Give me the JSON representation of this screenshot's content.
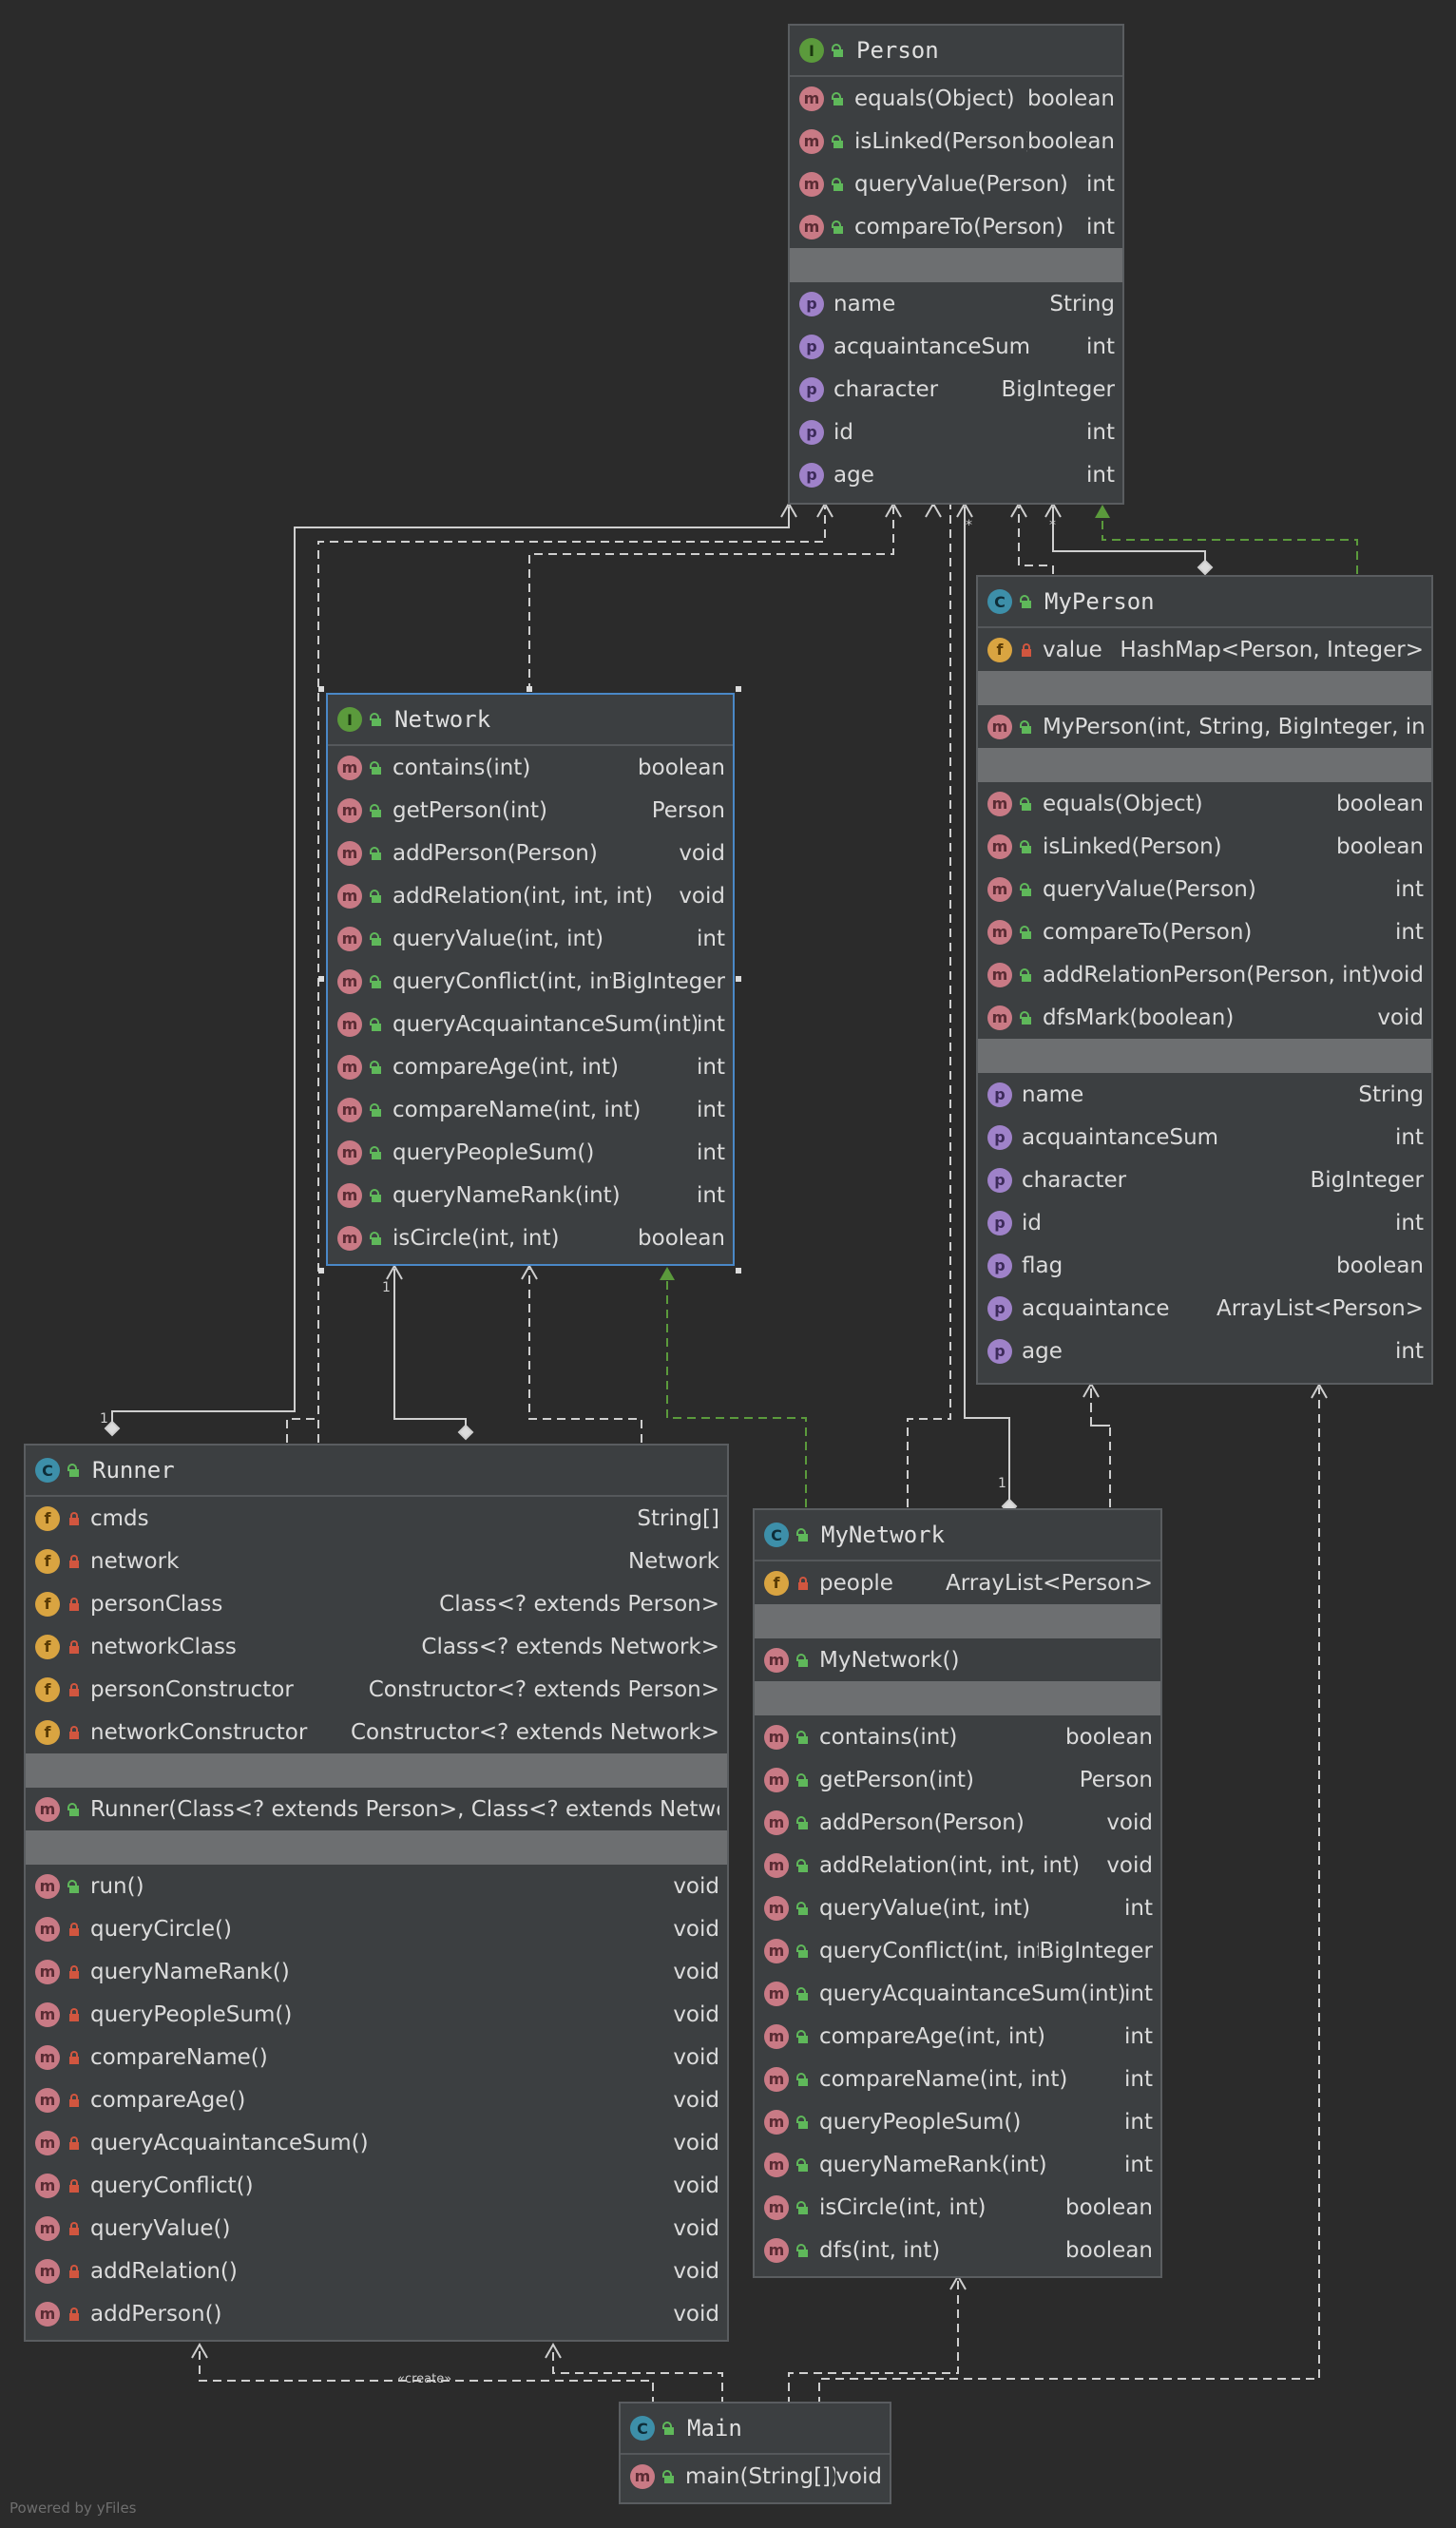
{
  "person": {
    "name": "Person",
    "kind_icon": "I",
    "methods": [
      {
        "label": "equals(Object)",
        "type": "boolean"
      },
      {
        "label": "isLinked(Person)",
        "type": "boolean"
      },
      {
        "label": "queryValue(Person)",
        "type": "int"
      },
      {
        "label": "compareTo(Person)",
        "type": "int"
      }
    ],
    "properties": [
      {
        "label": "name",
        "type": "String"
      },
      {
        "label": "acquaintanceSum",
        "type": "int"
      },
      {
        "label": "character",
        "type": "BigInteger"
      },
      {
        "label": "id",
        "type": "int"
      },
      {
        "label": "age",
        "type": "int"
      }
    ]
  },
  "network": {
    "name": "Network",
    "kind_icon": "I",
    "methods": [
      {
        "label": "contains(int)",
        "type": "boolean"
      },
      {
        "label": "getPerson(int)",
        "type": "Person"
      },
      {
        "label": "addPerson(Person)",
        "type": "void"
      },
      {
        "label": "addRelation(int, int, int)",
        "type": "void"
      },
      {
        "label": "queryValue(int, int)",
        "type": "int"
      },
      {
        "label": "queryConflict(int, int)",
        "type": "BigInteger"
      },
      {
        "label": "queryAcquaintanceSum(int)",
        "type": "int"
      },
      {
        "label": "compareAge(int, int)",
        "type": "int"
      },
      {
        "label": "compareName(int, int)",
        "type": "int"
      },
      {
        "label": "queryPeopleSum()",
        "type": "int"
      },
      {
        "label": "queryNameRank(int)",
        "type": "int"
      },
      {
        "label": "isCircle(int, int)",
        "type": "boolean"
      }
    ]
  },
  "myperson": {
    "name": "MyPerson",
    "kind_icon": "C",
    "fields": [
      {
        "label": "value",
        "type": "HashMap<Person, Integer>"
      }
    ],
    "constructors": [
      {
        "label": "MyPerson(int, String, BigInteger, int)",
        "type": ""
      }
    ],
    "methods": [
      {
        "label": "equals(Object)",
        "type": "boolean"
      },
      {
        "label": "isLinked(Person)",
        "type": "boolean"
      },
      {
        "label": "queryValue(Person)",
        "type": "int"
      },
      {
        "label": "compareTo(Person)",
        "type": "int"
      },
      {
        "label": "addRelationPerson(Person, int)",
        "type": "void"
      },
      {
        "label": "dfsMark(boolean)",
        "type": "void"
      }
    ],
    "properties": [
      {
        "label": "name",
        "type": "String"
      },
      {
        "label": "acquaintanceSum",
        "type": "int"
      },
      {
        "label": "character",
        "type": "BigInteger"
      },
      {
        "label": "id",
        "type": "int"
      },
      {
        "label": "flag",
        "type": "boolean"
      },
      {
        "label": "acquaintance",
        "type": "ArrayList<Person>"
      },
      {
        "label": "age",
        "type": "int"
      }
    ]
  },
  "runner": {
    "name": "Runner",
    "kind_icon": "C",
    "fields": [
      {
        "label": "cmds",
        "type": "String[]"
      },
      {
        "label": "network",
        "type": "Network"
      },
      {
        "label": "personClass",
        "type": "Class<? extends Person>"
      },
      {
        "label": "networkClass",
        "type": "Class<? extends Network>"
      },
      {
        "label": "personConstructor",
        "type": "Constructor<? extends Person>"
      },
      {
        "label": "networkConstructor",
        "type": "Constructor<? extends Network>"
      }
    ],
    "constructors": [
      {
        "label": "Runner(Class<? extends Person>, Class<? extends Network>)",
        "type": ""
      }
    ],
    "methods": [
      {
        "label": "run()",
        "type": "void",
        "access": "public"
      },
      {
        "label": "queryCircle()",
        "type": "void",
        "access": "private"
      },
      {
        "label": "queryNameRank()",
        "type": "void",
        "access": "private"
      },
      {
        "label": "queryPeopleSum()",
        "type": "void",
        "access": "private"
      },
      {
        "label": "compareName()",
        "type": "void",
        "access": "private"
      },
      {
        "label": "compareAge()",
        "type": "void",
        "access": "private"
      },
      {
        "label": "queryAcquaintanceSum()",
        "type": "void",
        "access": "private"
      },
      {
        "label": "queryConflict()",
        "type": "void",
        "access": "private"
      },
      {
        "label": "queryValue()",
        "type": "void",
        "access": "private"
      },
      {
        "label": "addRelation()",
        "type": "void",
        "access": "private"
      },
      {
        "label": "addPerson()",
        "type": "void",
        "access": "private"
      }
    ]
  },
  "mynetwork": {
    "name": "MyNetwork",
    "kind_icon": "C",
    "fields": [
      {
        "label": "people",
        "type": "ArrayList<Person>"
      }
    ],
    "constructors": [
      {
        "label": "MyNetwork()",
        "type": ""
      }
    ],
    "methods": [
      {
        "label": "contains(int)",
        "type": "boolean"
      },
      {
        "label": "getPerson(int)",
        "type": "Person"
      },
      {
        "label": "addPerson(Person)",
        "type": "void"
      },
      {
        "label": "addRelation(int, int, int)",
        "type": "void"
      },
      {
        "label": "queryValue(int, int)",
        "type": "int"
      },
      {
        "label": "queryConflict(int, int)",
        "type": "BigInteger"
      },
      {
        "label": "queryAcquaintanceSum(int)",
        "type": "int"
      },
      {
        "label": "compareAge(int, int)",
        "type": "int"
      },
      {
        "label": "compareName(int, int)",
        "type": "int"
      },
      {
        "label": "queryPeopleSum()",
        "type": "int"
      },
      {
        "label": "queryNameRank(int)",
        "type": "int"
      },
      {
        "label": "isCircle(int, int)",
        "type": "boolean"
      },
      {
        "label": "dfs(int, int)",
        "type": "boolean"
      }
    ]
  },
  "main": {
    "name": "Main",
    "kind_icon": "C",
    "methods": [
      {
        "label": "main(String[])",
        "type": "void"
      }
    ]
  },
  "icons": {
    "method": "m",
    "property": "p",
    "field": "f"
  },
  "labels": {
    "creates": "«create»",
    "mult_one": "1",
    "mult_many": "*"
  },
  "footer": "Powered by yFiles",
  "colors": {
    "background": "#2b2b2b",
    "box": "#3c3f41",
    "selected_border": "#4a88c7",
    "realization": "#5b9a3c"
  }
}
